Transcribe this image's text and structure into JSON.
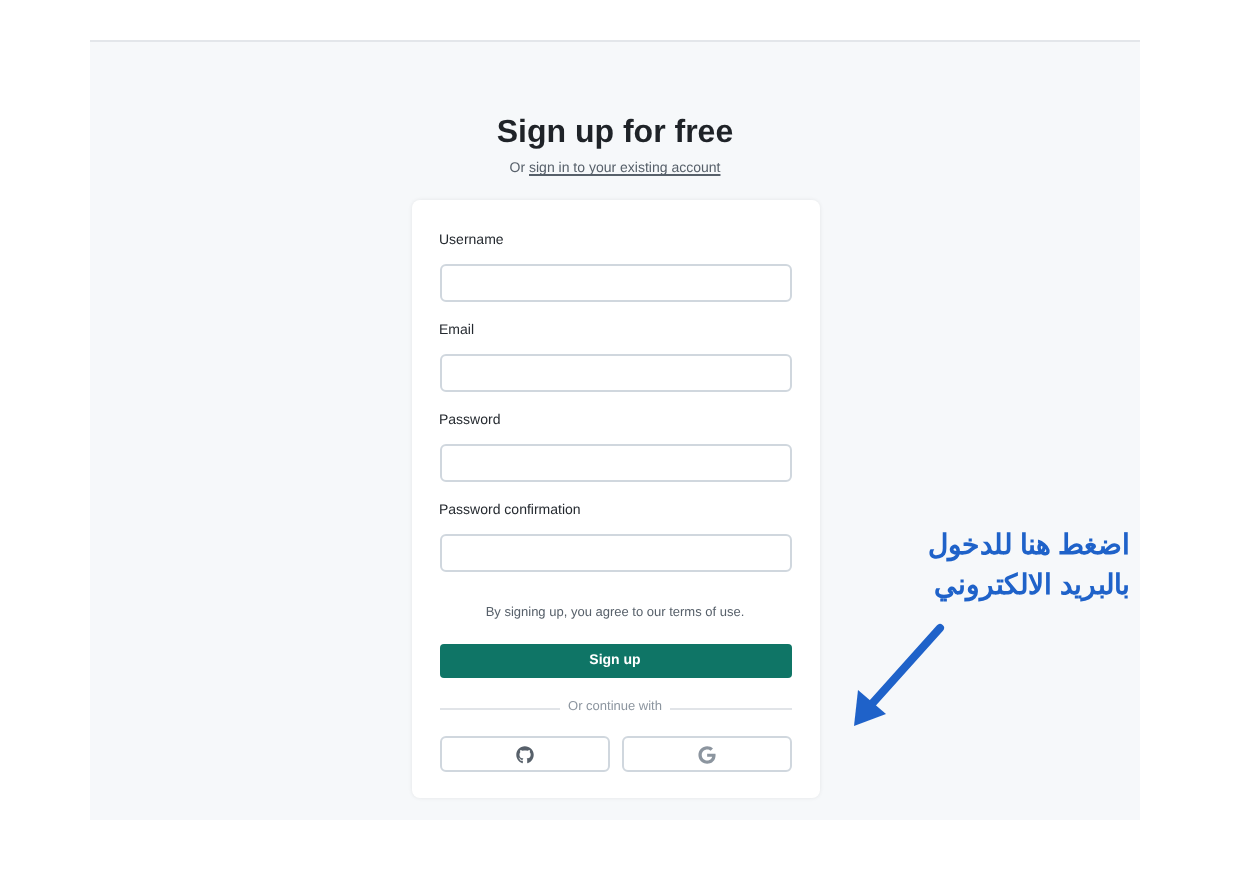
{
  "heading": "Sign up for free",
  "subtitle": {
    "prefix": "Or",
    "link": "sign in to your existing account"
  },
  "fields": [
    {
      "label": "Username"
    },
    {
      "label": "Email"
    },
    {
      "label": "Password"
    },
    {
      "label": "Password confirmation"
    }
  ],
  "terms": "By signing up, you agree to our terms of use.",
  "submit": "Sign up",
  "divider": "Or continue with",
  "social": [
    {
      "kind": "github"
    },
    {
      "kind": "google"
    }
  ],
  "annotation": {
    "lines": [
      "اضغط هنا للدخول",
      "بالبريد الالكتروني"
    ]
  }
}
